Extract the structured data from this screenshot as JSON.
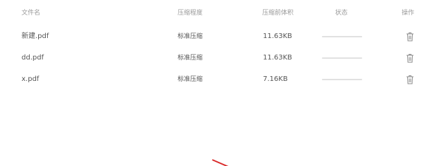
{
  "table": {
    "headers": {
      "name": "文件名",
      "level": "压缩程度",
      "size": "压缩前体积",
      "status": "状态",
      "action": "操作"
    },
    "rows": [
      {
        "name": "新建.pdf",
        "level": "标准压缩",
        "size": "11.63KB",
        "progress": 0,
        "action_icon": "trash-icon"
      },
      {
        "name": "dd.pdf",
        "level": "标准压缩",
        "size": "11.63KB",
        "progress": 0,
        "action_icon": "trash-icon"
      },
      {
        "name": "x.pdf",
        "level": "标准压缩",
        "size": "7.16KB",
        "progress": 0,
        "action_icon": "trash-icon"
      }
    ]
  },
  "colors": {
    "header_text": "#9a9a9a",
    "body_text": "#555555",
    "progress_track": "#e1e1e1",
    "annotation_arrow": "#d92b2b"
  }
}
